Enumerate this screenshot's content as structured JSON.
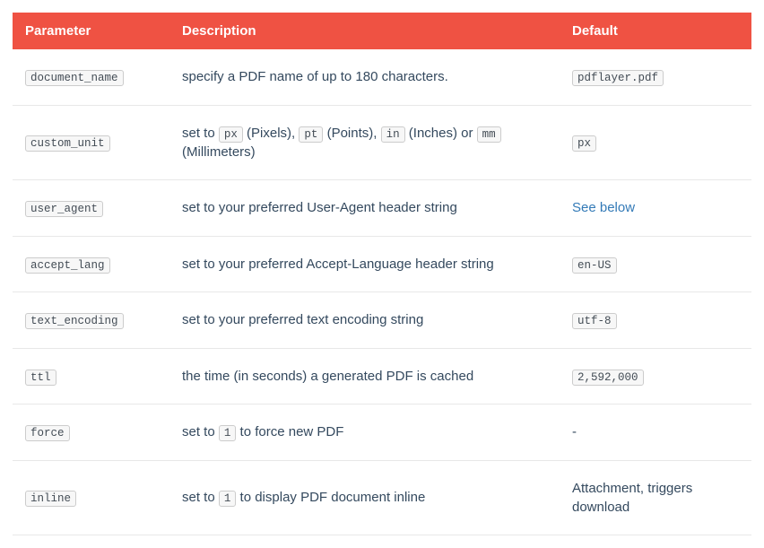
{
  "headers": {
    "parameter": "Parameter",
    "description": "Description",
    "default": "Default"
  },
  "rows": [
    {
      "param": "document_name",
      "desc": {
        "type": "plain",
        "text": "specify a PDF name of up to 180 characters."
      },
      "default": {
        "type": "code",
        "text": "pdflayer.pdf"
      }
    },
    {
      "param": "custom_unit",
      "desc": {
        "type": "mixed",
        "parts": [
          {
            "t": "text",
            "v": "set to "
          },
          {
            "t": "code",
            "v": "px"
          },
          {
            "t": "text",
            "v": " (Pixels), "
          },
          {
            "t": "code",
            "v": "pt"
          },
          {
            "t": "text",
            "v": " (Points), "
          },
          {
            "t": "code",
            "v": "in"
          },
          {
            "t": "text",
            "v": " (Inches) or "
          },
          {
            "t": "code",
            "v": "mm"
          },
          {
            "t": "text",
            "v": " (Millimeters)"
          }
        ]
      },
      "default": {
        "type": "code",
        "text": "px"
      }
    },
    {
      "param": "user_agent",
      "desc": {
        "type": "plain",
        "text": "set to your preferred User-Agent header string"
      },
      "default": {
        "type": "link",
        "text": "See below"
      }
    },
    {
      "param": "accept_lang",
      "desc": {
        "type": "plain",
        "text": "set to your preferred Accept-Language header string"
      },
      "default": {
        "type": "code",
        "text": "en-US"
      }
    },
    {
      "param": "text_encoding",
      "desc": {
        "type": "plain",
        "text": "set to your preferred text encoding string"
      },
      "default": {
        "type": "code",
        "text": "utf-8"
      }
    },
    {
      "param": "ttl",
      "desc": {
        "type": "plain",
        "text": "the time (in seconds) a generated PDF is cached"
      },
      "default": {
        "type": "code",
        "text": "2,592,000"
      }
    },
    {
      "param": "force",
      "desc": {
        "type": "mixed",
        "parts": [
          {
            "t": "text",
            "v": "set to "
          },
          {
            "t": "code",
            "v": "1"
          },
          {
            "t": "text",
            "v": " to force new PDF"
          }
        ]
      },
      "default": {
        "type": "plain",
        "text": "-"
      }
    },
    {
      "param": "inline",
      "desc": {
        "type": "mixed",
        "parts": [
          {
            "t": "text",
            "v": "set to "
          },
          {
            "t": "code",
            "v": "1"
          },
          {
            "t": "text",
            "v": " to display PDF document inline"
          }
        ]
      },
      "default": {
        "type": "plain",
        "text": "Attachment, triggers download"
      }
    }
  ]
}
